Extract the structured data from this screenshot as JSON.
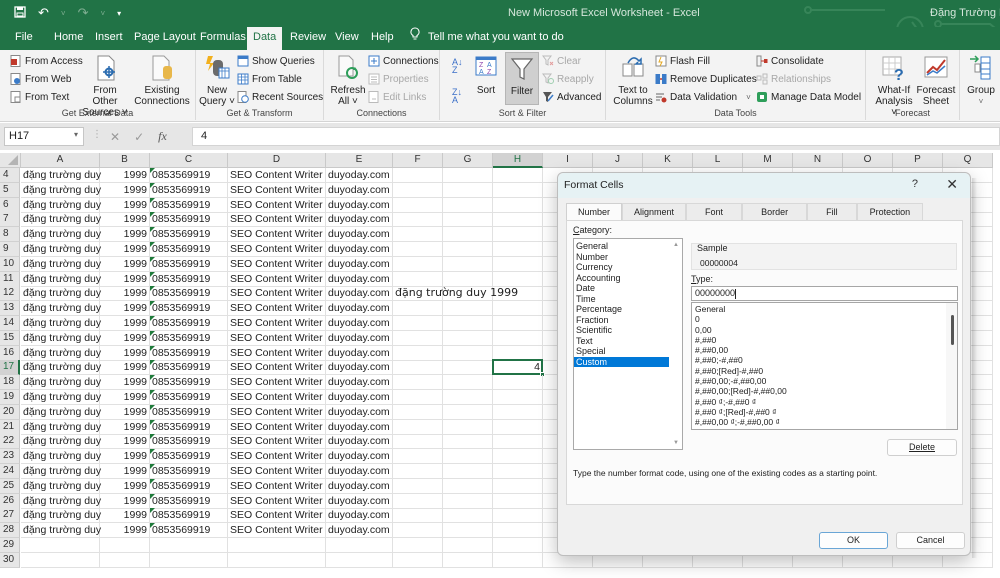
{
  "window": {
    "title": "New Microsoft Excel Worksheet  -  Excel",
    "user": "Đặng Trường Duy"
  },
  "menu_tabs": [
    "File",
    "Home",
    "Insert",
    "Page Layout",
    "Formulas",
    "Data",
    "Review",
    "View",
    "Help"
  ],
  "active_tab": "Data",
  "tell_me": "Tell me what you want to do",
  "ribbon": {
    "get_external_data": {
      "label": "Get External Data",
      "from_access": "From Access",
      "from_web": "From Web",
      "from_text": "From Text",
      "from_other_sources": [
        "From Other",
        "Sources ˅"
      ],
      "existing_connections": [
        "Existing",
        "Connections"
      ]
    },
    "get_transform": {
      "label": "Get & Transform",
      "new_query": [
        "New",
        "Query ˅"
      ],
      "show_queries": "Show Queries",
      "from_table": "From Table",
      "recent_sources": "Recent Sources"
    },
    "connections": {
      "label": "Connections",
      "refresh_all": [
        "Refresh",
        "All ˅"
      ],
      "connections": "Connections",
      "properties": "Properties",
      "edit_links": "Edit Links"
    },
    "sort_filter": {
      "label": "Sort & Filter",
      "sort": "Sort",
      "filter": "Filter",
      "clear": "Clear",
      "reapply": "Reapply",
      "advanced": "Advanced"
    },
    "data_tools": {
      "label": "Data Tools",
      "text_to_columns": [
        "Text to",
        "Columns"
      ],
      "flash_fill": "Flash Fill",
      "remove_duplicates": "Remove Duplicates",
      "data_validation": "Data Validation",
      "consolidate": "Consolidate",
      "relationships": "Relationships",
      "manage_data_model": "Manage Data Model"
    },
    "forecast": {
      "label": "Forecast",
      "what_if": [
        "What-If",
        "Analysis ˅"
      ],
      "forecast_sheet": [
        "Forecast",
        "Sheet"
      ]
    },
    "outline": {
      "group": [
        "Group",
        "˅"
      ]
    }
  },
  "formula_bar": {
    "name_box": "H17",
    "cancel": "✕",
    "enter": "✓",
    "fx": "fx",
    "value": "4"
  },
  "sheet": {
    "columns": [
      "A",
      "B",
      "C",
      "D",
      "E",
      "F",
      "G",
      "H",
      "I",
      "J",
      "K",
      "L",
      "M",
      "N",
      "O",
      "P",
      "Q"
    ],
    "selected_column": "H",
    "selected_row": 17,
    "row_numbers": [
      4,
      5,
      6,
      7,
      8,
      9,
      10,
      11,
      12,
      13,
      14,
      15,
      16,
      17,
      18,
      19,
      20,
      21,
      22,
      23,
      24,
      25,
      26,
      27,
      28,
      29,
      30
    ],
    "data_rows": {
      "first": 4,
      "last": 28,
      "name": "đặng trường duy",
      "year": "1999",
      "phone": "0853569919",
      "job": "SEO Content Writer",
      "site": "duyoday.com"
    },
    "extra_cells": [
      {
        "ref": "F12",
        "value": "đặng trường duy 1999"
      },
      {
        "ref": "H17",
        "value": "4"
      }
    ]
  },
  "dialog": {
    "title": "Format Cells",
    "help": "?",
    "close": "✕",
    "tabs": [
      "Number",
      "Alignment",
      "Font",
      "Border",
      "Fill",
      "Protection"
    ],
    "active_tab": "Number",
    "category_label_u": "C",
    "category_label_rest": "ategory:",
    "categories": [
      "General",
      "Number",
      "Currency",
      "Accounting",
      "Date",
      "Time",
      "Percentage",
      "Fraction",
      "Scientific",
      "Text",
      "Special",
      "Custom"
    ],
    "selected_category": "Custom",
    "sample_label": "Sample",
    "sample_value": "00000004",
    "type_label_u": "T",
    "type_label_rest": "ype:",
    "type_value": "00000000",
    "type_list": [
      "General",
      "0",
      "0,00",
      "#,##0",
      "#,##0,00",
      "#,##0;-#,##0",
      "#,##0;[Red]-#,##0",
      "#,##0,00;-#,##0,00",
      "#,##0,00;[Red]-#,##0,00",
      "#,##0 ₫;-#,##0 ₫",
      "#,##0 ₫;[Red]-#,##0 ₫",
      "#,##0,00 ₫;-#,##0,00 ₫"
    ],
    "delete_label": "Delete",
    "hint": "Type the number format code, using one of the existing codes as a starting point.",
    "ok_label": "OK",
    "cancel_label": "Cancel"
  }
}
